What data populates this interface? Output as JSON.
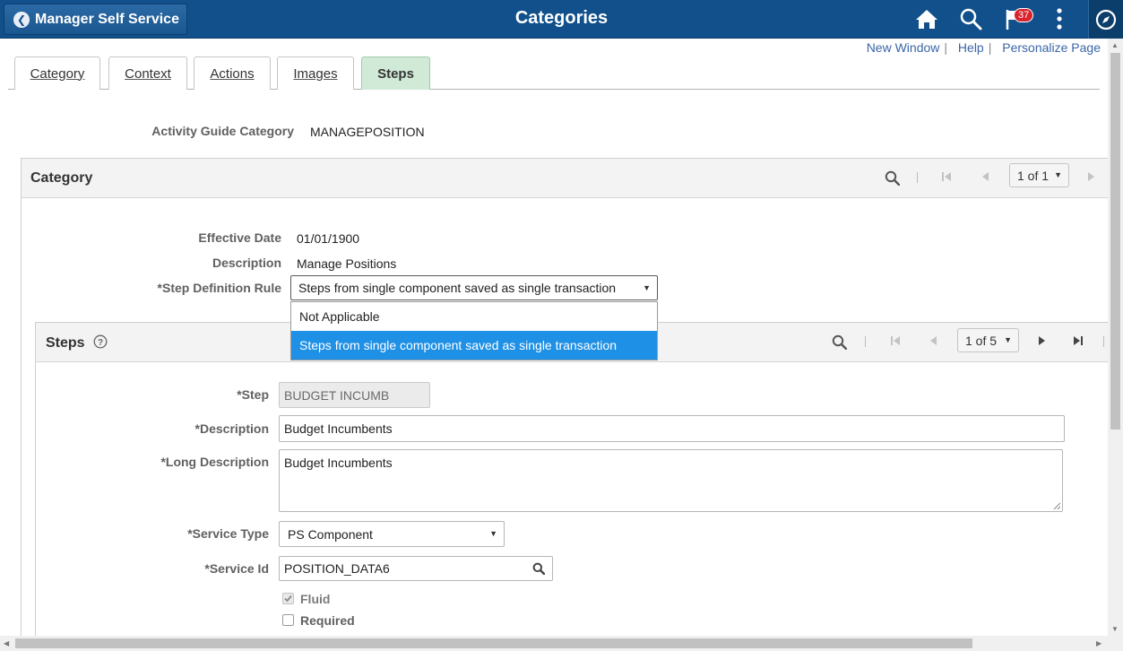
{
  "header": {
    "back_label": "Manager Self Service",
    "title": "Categories",
    "notification_count": "37",
    "colors": {
      "bar": "#11508b"
    }
  },
  "links": {
    "new_window": "New Window",
    "help": "Help",
    "personalize": "Personalize Page",
    "separator": "|"
  },
  "tabs": [
    {
      "label": "Category"
    },
    {
      "label": "Context"
    },
    {
      "label": "Actions"
    },
    {
      "label": "Images"
    },
    {
      "label": "Steps",
      "active": true
    }
  ],
  "activity_guide": {
    "label": "Activity Guide Category",
    "value": "MANAGEPOSITION"
  },
  "category_box": {
    "title": "Category",
    "pager": "1 of 1",
    "effective_date_label": "Effective Date",
    "effective_date": "01/01/1900",
    "description_label": "Description",
    "description": "Manage Positions",
    "step_rule_label": "*Step Definition Rule",
    "step_rule_value": "Steps from single component saved as single transaction",
    "step_rule_options": [
      "Not Applicable",
      "Steps from single component saved as single transaction"
    ]
  },
  "steps_box": {
    "title": "Steps",
    "pager": "1 of 5",
    "step_label": "*Step",
    "step_value": "BUDGET INCUMB",
    "description_label": "*Description",
    "description_value": "Budget Incumbents",
    "long_description_label": "*Long Description",
    "long_description_value": "Budget Incumbents",
    "service_type_label": "*Service Type",
    "service_type_value": "PS Component",
    "service_id_label": "*Service Id",
    "service_id_value": "POSITION_DATA6",
    "fluid_label": "Fluid",
    "fluid_checked": true,
    "required_label": "Required",
    "required_checked": false
  }
}
